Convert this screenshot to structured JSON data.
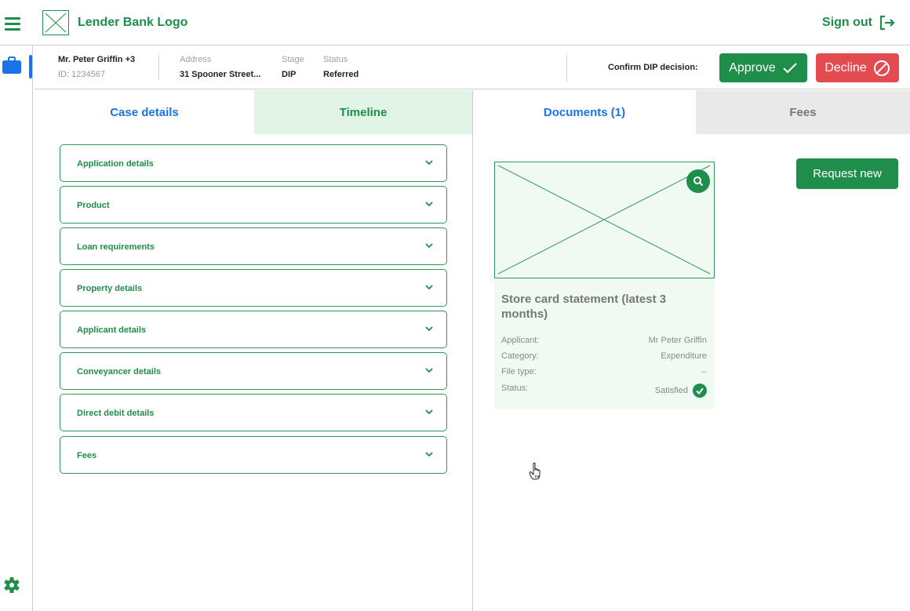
{
  "header": {
    "logo_text": "Lender Bank Logo",
    "sign_out_label": "Sign out"
  },
  "case_bar": {
    "applicant_name": "Mr. Peter Griffin +3",
    "applicant_id": "ID: 1234567",
    "address_label": "Address",
    "address_value": "31 Spooner Street...",
    "stage_label": "Stage",
    "stage_value": "DIP",
    "status_label": "Status",
    "status_value": "Referred",
    "confirm_label": "Confirm DIP decision:",
    "approve_label": "Approve",
    "decline_label": "Decline"
  },
  "tabs": [
    {
      "label": "Case details"
    },
    {
      "label": "Timeline"
    },
    {
      "label": "Documents (1)"
    },
    {
      "label": "Fees"
    }
  ],
  "accordions": [
    {
      "label": "Application details"
    },
    {
      "label": "Product"
    },
    {
      "label": "Loan requirements"
    },
    {
      "label": "Property details"
    },
    {
      "label": "Applicant details"
    },
    {
      "label": "Conveyancer details"
    },
    {
      "label": "Direct debit details"
    },
    {
      "label": "Fees"
    }
  ],
  "document": {
    "title": "Store card statement (latest 3 months)",
    "meta": [
      {
        "key": "Applicant:",
        "value": "Mr Peter Griffin"
      },
      {
        "key": "Category:",
        "value": "Expenditure"
      },
      {
        "key": "File type:",
        "value": "--"
      },
      {
        "key": "Status:",
        "value": "Satisfied"
      }
    ]
  },
  "request_new_label": "Request new",
  "colors": {
    "brand_green": "#1e8e4a",
    "link_blue": "#1a73e8",
    "decline_red": "#e24b50",
    "timeline_tab_bg": "#e2f4e6",
    "fees_tab_bg": "#e9e9e9"
  },
  "icons": [
    "menu-icon",
    "logo-placeholder-icon",
    "sign-out-icon",
    "briefcase-icon",
    "settings-gear-icon",
    "check-icon",
    "prohibited-icon",
    "chevron-down-icon",
    "search-icon",
    "check-circle-icon",
    "hand-pointer-icon"
  ]
}
